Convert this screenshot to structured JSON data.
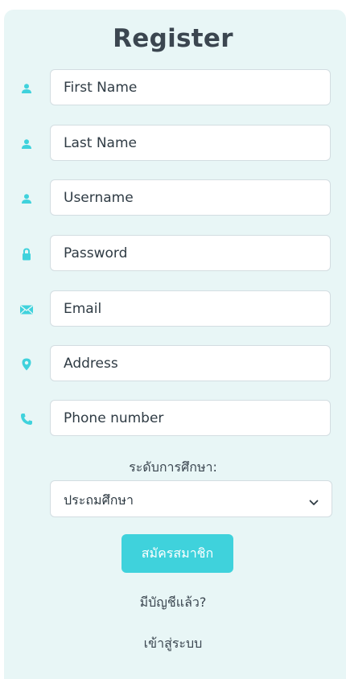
{
  "form": {
    "title": "Register",
    "fields": [
      {
        "icon": "user-icon",
        "placeholder": "First Name"
      },
      {
        "icon": "user-icon",
        "placeholder": "Last Name"
      },
      {
        "icon": "user-icon",
        "placeholder": "Username"
      },
      {
        "icon": "lock-icon",
        "placeholder": "Password"
      },
      {
        "icon": "envelope-icon",
        "placeholder": "Email"
      },
      {
        "icon": "map-marker-icon",
        "placeholder": "Address"
      },
      {
        "icon": "phone-icon",
        "placeholder": "Phone number"
      }
    ],
    "education_label": "ระดับการศึกษา:",
    "education_selected": "ประถมศึกษา",
    "submit_label": "สมัครสมาชิก",
    "has_account_text": "มีบัญชีแล้ว?",
    "login_link": "เข้าสู่ระบบ"
  },
  "colors": {
    "accent": "#3fd2dc",
    "card_background": "#e8f6f6",
    "text": "#3b4650"
  }
}
